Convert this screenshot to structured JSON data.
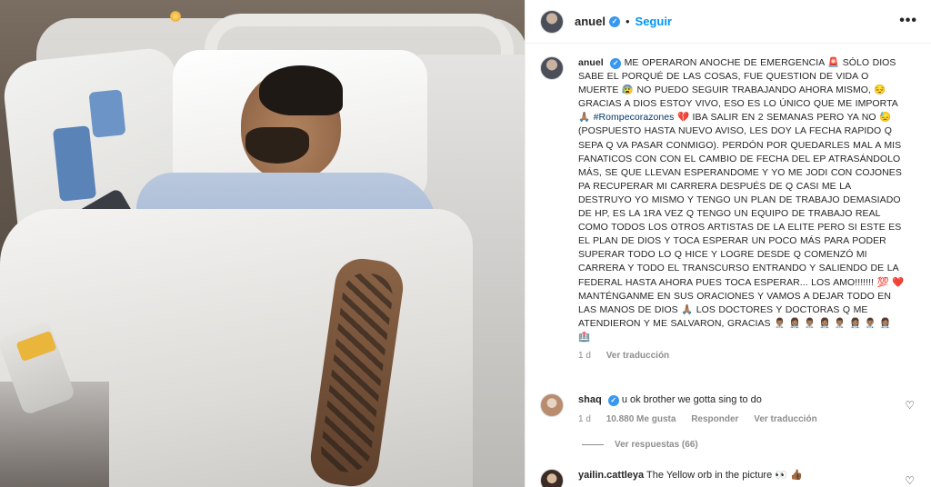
{
  "post": {
    "username": "anuel",
    "follow_label": "Seguir",
    "more_label": "•••",
    "caption_username": "anuel",
    "caption_part1": "ME OPERARON ANOCHE DE EMERGENCIA 🚨 SÓLO DIOS SABE EL PORQUÉ DE LAS COSAS, FUE QUESTION DE VIDA O MUERTE 😰 NO PUEDO SEGUIR TRABAJANDO AHORA MISMO, 😔 GRACIAS A DIOS ESTOY VIVO, ESO ES LO ÚNICO QUE ME IMPORTA 🙏🏽",
    "hashtag": "#Rompecorazones",
    "caption_part2": "💔 IBA SALIR EN 2 SEMANAS PERO YA NO 😓 (POSPUESTO HASTA NUEVO AVISO, LES DOY LA FECHA RAPIDO Q SEPA Q VA PASAR CONMIGO). PERDÓN POR QUEDARLES MAL A MIS FANATICOS CON CON EL CAMBIO DE FECHA DEL EP ATRASÁNDOLO MÁS, SE QUE LLEVAN ESPERANDOME Y YO ME JODI CON COJONES PA RECUPERAR MI CARRERA DESPUÉS DE Q CASI ME LA DESTRUYO YO MISMO Y TENGO UN PLAN DE TRABAJO DEMASIADO DE HP, ES LA 1RA VEZ Q TENGO UN EQUIPO DE TRABAJO REAL COMO TODOS LOS OTROS ARTISTAS DE LA ELITE PERO SI ESTE ES EL PLAN DE DIOS Y TOCA ESPERAR UN POCO MÁS PARA PODER SUPERAR TODO LO Q HICE Y LOGRE DESDE Q COMENZÓ MI CARRERA Y TODO EL TRANSCURSO ENTRANDO Y SALIENDO DE LA FEDERAL HASTA AHORA PUES TOCA ESPERAR... LOS AMO!!!!!!! 💯 ❤️ MANTÉNGANME EN SUS ORACIONES Y VAMOS A DEJAR TODO EN LAS MANOS DE DIOS 🙏🏽 LOS DOCTORES Y DOCTORAS Q ME ATENDIERON Y ME SALVARON, GRACIAS 👨🏽‍⚕️ 👩🏽‍⚕️ 👨🏽‍⚕️ 👩🏽‍⚕️ 👨🏽‍⚕️ 👩🏽‍⚕️ 👨🏽‍⚕️ 👩🏽‍⚕️ 🏥",
    "age": "1 d",
    "see_translation": "Ver traducción"
  },
  "comments": [
    {
      "username": "shaq",
      "text": "u ok brother we gotta sing to do",
      "age": "1 d",
      "likes": "10.880 Me gusta",
      "reply_label": "Responder",
      "see_translation": "Ver traducción"
    },
    {
      "username": "yailin.cattleya",
      "text": "The Yellow orb in the picture 👀 👍🏾"
    }
  ],
  "view_replies": "Ver respuestas (66)",
  "icons": {
    "verified": "verified-badge-icon",
    "heart": "heart-icon",
    "more": "more-options-icon"
  },
  "colors": {
    "accent": "#0095f6",
    "verified": "#3897f0",
    "text": "#262626",
    "muted": "#8e8e8e"
  }
}
